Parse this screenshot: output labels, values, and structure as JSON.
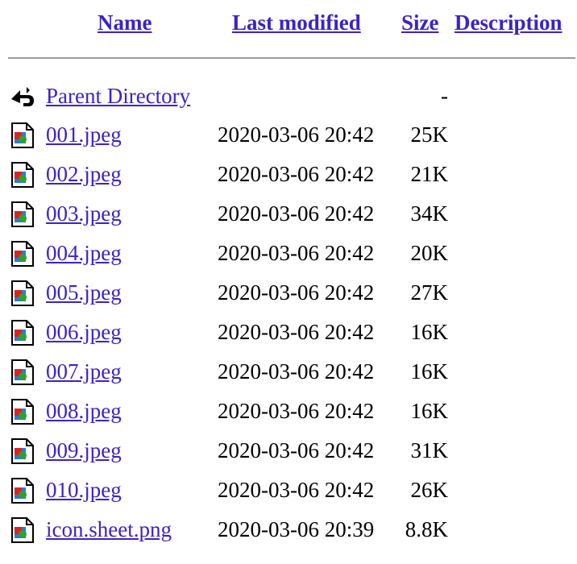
{
  "header": {
    "name": "Name",
    "last_modified": "Last modified",
    "size": "Size",
    "description": "Description"
  },
  "parent": {
    "icon": "back-arrow-icon",
    "label": "Parent Directory",
    "size": "-"
  },
  "files": [
    {
      "icon": "image-file-icon",
      "name": "001.jpeg",
      "modified": "2020-03-06 20:42",
      "size": "25K"
    },
    {
      "icon": "image-file-icon",
      "name": "002.jpeg",
      "modified": "2020-03-06 20:42",
      "size": "21K"
    },
    {
      "icon": "image-file-icon",
      "name": "003.jpeg",
      "modified": "2020-03-06 20:42",
      "size": "34K"
    },
    {
      "icon": "image-file-icon",
      "name": "004.jpeg",
      "modified": "2020-03-06 20:42",
      "size": "20K"
    },
    {
      "icon": "image-file-icon",
      "name": "005.jpeg",
      "modified": "2020-03-06 20:42",
      "size": "27K"
    },
    {
      "icon": "image-file-icon",
      "name": "006.jpeg",
      "modified": "2020-03-06 20:42",
      "size": "16K"
    },
    {
      "icon": "image-file-icon",
      "name": "007.jpeg",
      "modified": "2020-03-06 20:42",
      "size": "16K"
    },
    {
      "icon": "image-file-icon",
      "name": "008.jpeg",
      "modified": "2020-03-06 20:42",
      "size": "16K"
    },
    {
      "icon": "image-file-icon",
      "name": "009.jpeg",
      "modified": "2020-03-06 20:42",
      "size": "31K"
    },
    {
      "icon": "image-file-icon",
      "name": "010.jpeg",
      "modified": "2020-03-06 20:42",
      "size": "26K"
    },
    {
      "icon": "image-file-icon",
      "name": "icon.sheet.png",
      "modified": "2020-03-06 20:39",
      "size": "8.8K"
    }
  ],
  "colors": {
    "link": "#3b24c4",
    "rule": "#9a9a9a"
  }
}
